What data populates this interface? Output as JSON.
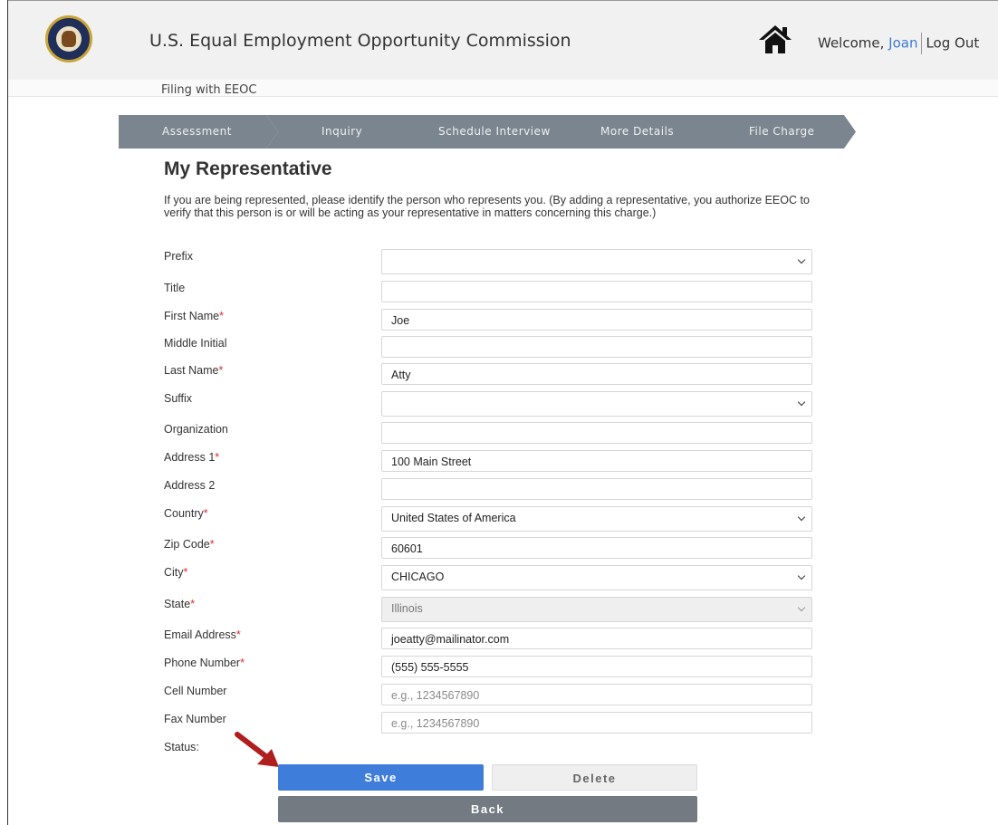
{
  "header": {
    "agency_name": "U.S. Equal Employment Opportunity Commission",
    "welcome_prefix": "Welcome, ",
    "user_name": "Joan",
    "logout_label": "Log Out",
    "home_icon": "home-icon",
    "seal_icon": "eeoc-seal-logo"
  },
  "subheader": {
    "filing_label": "Filing with EEOC"
  },
  "steps": [
    {
      "label": "Assessment"
    },
    {
      "label": "Inquiry"
    },
    {
      "label": "Schedule Interview"
    },
    {
      "label": "More Details"
    },
    {
      "label": "File Charge"
    }
  ],
  "page": {
    "title": "My Representative",
    "intro": "If you are being represented, please identify the person who represents you. (By adding a representative, you authorize EEOC to verify that this person is or will be acting as your representative in matters concerning this charge.)"
  },
  "form": {
    "prefix": {
      "label": "Prefix",
      "value": ""
    },
    "title": {
      "label": "Title",
      "value": ""
    },
    "first_name": {
      "label": "First Name",
      "value": "Joe"
    },
    "middle_initial": {
      "label": "Middle Initial",
      "value": ""
    },
    "last_name": {
      "label": "Last Name",
      "value": "Atty"
    },
    "suffix": {
      "label": "Suffix",
      "value": ""
    },
    "organization": {
      "label": "Organization",
      "value": ""
    },
    "address1": {
      "label": "Address 1",
      "value": "100 Main Street"
    },
    "address2": {
      "label": "Address 2",
      "value": ""
    },
    "country": {
      "label": "Country",
      "value": "United States of America"
    },
    "zip": {
      "label": "Zip Code",
      "value": "60601"
    },
    "city": {
      "label": "City",
      "value": "CHICAGO"
    },
    "state": {
      "label": "State",
      "value": "Illinois"
    },
    "email": {
      "label": "Email Address",
      "value": "joeatty@mailinator.com"
    },
    "phone": {
      "label": "Phone Number",
      "value": "(555) 555-5555"
    },
    "cell": {
      "label": "Cell Number",
      "placeholder": "e.g., 1234567890"
    },
    "fax": {
      "label": "Fax Number",
      "placeholder": "e.g., 1234567890"
    },
    "status": {
      "label": "Status:"
    },
    "required_mark": "*"
  },
  "buttons": {
    "save": "Save",
    "delete": "Delete",
    "back": "Back"
  },
  "colors": {
    "step_bar": "#7a858f",
    "save": "#3f7ddb",
    "back": "#737a82",
    "required": "#d9302e",
    "link": "#3a7bd5",
    "annotation_arrow": "#b01e1e"
  }
}
